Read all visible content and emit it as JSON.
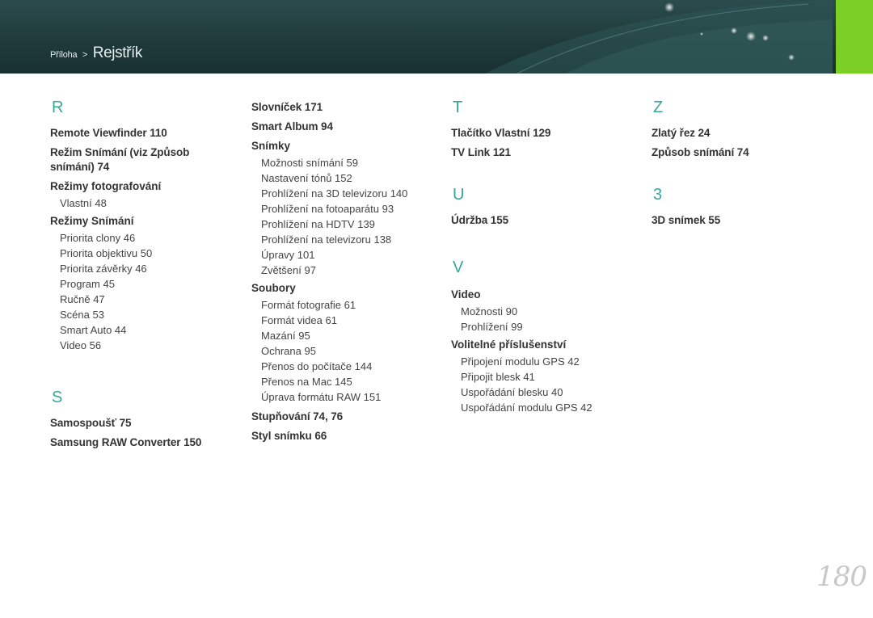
{
  "header": {
    "breadcrumb_parent": "Příloha",
    "breadcrumb_sep": ">",
    "breadcrumb_current": "Rejstřík",
    "accent_color": "#7ccf24"
  },
  "col1": {
    "r_letter": "R",
    "remote": "Remote Viewfinder  110",
    "rezim_zpusob": "Režim Snímání (viz Způsob snímání)  74",
    "rezimy_foto": "Režimy fotografování",
    "vlastni": "Vlastní  48",
    "rezimy_snimani": "Režimy Snímání",
    "priorita_clony": "Priorita clony  46",
    "priorita_objektivu": "Priorita objektivu  50",
    "priorita_zaverky": "Priorita závěrky  46",
    "program": "Program  45",
    "rucne": "Ručně  47",
    "scena": "Scéna  53",
    "smart_auto": "Smart Auto  44",
    "video": "Video  56",
    "s_letter": "S",
    "samospoust": "Samospoušť  75",
    "samsung_raw": "Samsung RAW Converter  150"
  },
  "col2": {
    "slovnicek": "Slovníček  171",
    "smart_album": "Smart Album  94",
    "snimky": "Snímky",
    "moznosti_snimani": "Možnosti snímání  59",
    "nastaveni_tonu": "Nastavení tónů  152",
    "prohl_3d": "Prohlížení na 3D televizoru  140",
    "prohl_foto": "Prohlížení na fotoaparátu  93",
    "prohl_hdtv": "Prohlížení na HDTV  139",
    "prohl_tv": "Prohlížení na televizoru  138",
    "upravy": "Úpravy  101",
    "zvetseni": "Zvětšení  97",
    "soubory": "Soubory",
    "format_foto": "Formát fotografie  61",
    "format_videa": "Formát videa  61",
    "mazani": "Mazání  95",
    "ochrana": "Ochrana  95",
    "prenos_pc": "Přenos do počítače  144",
    "prenos_mac": "Přenos na Mac  145",
    "uprava_raw": "Úprava formátu RAW  151",
    "stupnovani": "Stupňování  74, 76",
    "styl_snimku": "Styl snímku  66"
  },
  "col3": {
    "t_letter": "T",
    "tlacitko": "Tlačítko Vlastní  129",
    "tv_link": "TV Link  121",
    "u_letter": "U",
    "udrzba": "Údržba  155",
    "v_letter": "V",
    "video": "Video",
    "video_moznosti": "Možnosti  90",
    "video_prohlizeni": "Prohlížení  99",
    "volitelne": "Volitelné příslušenství",
    "pripojeni_gps": "Připojení modulu GPS  42",
    "pripojit_blesk": "Připojit blesk  41",
    "usporadani_blesku": "Uspořádání blesku  40",
    "usporadani_gps": "Uspořádání modulu GPS  42"
  },
  "col4": {
    "z_letter": "Z",
    "zlaty_rez": "Zlatý řez  24",
    "zpusob_snimani": "Způsob snímání  74",
    "three_letter": "3",
    "snimek_3d": "3D snímek  55"
  },
  "page_number": "180",
  "letter_color": "#35a89a"
}
